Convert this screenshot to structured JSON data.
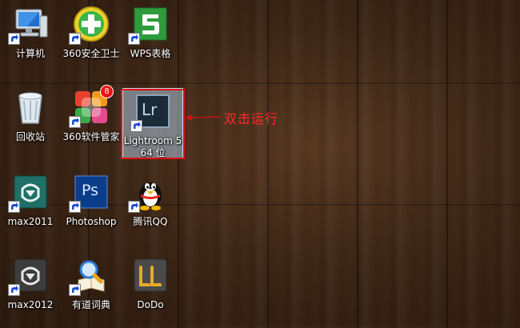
{
  "desktop": {
    "icons": [
      {
        "label": "计算机"
      },
      {
        "label": "360安全卫士"
      },
      {
        "label": "WPS表格"
      },
      {
        "label": "回收站"
      },
      {
        "label": "360软件管家",
        "badge": "8"
      },
      {
        "label": "Lightroom 5 64 位",
        "glyph_text": "Lr"
      },
      {
        "label": "max2011"
      },
      {
        "label": "Photoshop",
        "glyph_text": "Ps"
      },
      {
        "label": "腾讯QQ"
      },
      {
        "label": "max2012"
      },
      {
        "label": "有道词典"
      },
      {
        "label": "DoDo"
      }
    ]
  },
  "annotation": {
    "text": "双击运行",
    "color": "#e10f0f"
  }
}
